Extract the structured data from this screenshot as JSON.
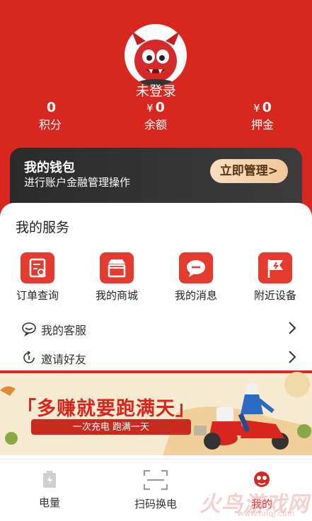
{
  "profile": {
    "nickname": "未登录"
  },
  "stats": [
    {
      "currency": "",
      "value": "0",
      "label": "积分"
    },
    {
      "currency": "¥",
      "value": "0",
      "label": "余额"
    },
    {
      "currency": "¥",
      "value": "0",
      "label": "押金"
    }
  ],
  "wallet": {
    "title": "我的钱包",
    "subtitle": "进行账户金融管理操作",
    "button": "立即管理>"
  },
  "services": {
    "title": "我的服务",
    "items": [
      {
        "label": "订单查询",
        "icon": "order-search-icon"
      },
      {
        "label": "我的商城",
        "icon": "shop-icon"
      },
      {
        "label": "我的消息",
        "icon": "message-icon"
      },
      {
        "label": "附近设备",
        "icon": "nearby-device-icon"
      }
    ],
    "rows": [
      {
        "label": "我的客服",
        "icon": "customer-service-icon"
      },
      {
        "label": "邀请好友",
        "icon": "invite-icon"
      }
    ]
  },
  "banner": {
    "title": "「多赚就要跑满天」",
    "subtitle": "一次充电 跑满一天"
  },
  "tabs": [
    {
      "label": "电量",
      "icon": "battery-icon",
      "active": false
    },
    {
      "label": "扫码换电",
      "icon": "scan-icon",
      "active": false
    },
    {
      "label": "我的",
      "icon": "profile-icon",
      "active": true
    }
  ],
  "watermark": {
    "text": "火鸟游戏网",
    "url": "www.hnqj.com"
  },
  "colors": {
    "primary": "#d7271f",
    "service_icon": "#e53a2e",
    "wallet_bg": "#2f2f2f",
    "wallet_button": "#f3d1a9"
  }
}
